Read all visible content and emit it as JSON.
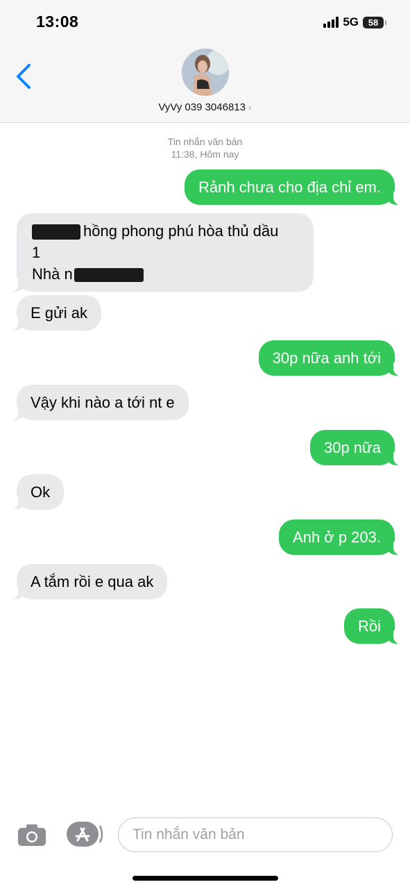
{
  "status_bar": {
    "time": "13:08",
    "network": "5G",
    "battery": "58",
    "icons": [
      "signal-icon",
      "battery-icon"
    ]
  },
  "header": {
    "back_icon": "chevron-left-icon",
    "contact_name": "VyVy 039 3046813",
    "contact_chevron": "›"
  },
  "thread": {
    "meta_type": "Tin nhắn văn bản",
    "meta_time": "11:38, Hôm nay",
    "messages": [
      {
        "direction": "out",
        "text": "Rảnh chưa cho địa chỉ em."
      },
      {
        "direction": "in",
        "line1": "hồng phong phú hòa thủ dầu",
        "line2": "1",
        "line3": "Nhà n"
      },
      {
        "direction": "in",
        "text": "E gửi ak"
      },
      {
        "direction": "out",
        "text": "30p nữa anh tới"
      },
      {
        "direction": "in",
        "text": "Vậy khi nào a tới nt e"
      },
      {
        "direction": "out",
        "text": "30p nữa"
      },
      {
        "direction": "in",
        "text": "Ok"
      },
      {
        "direction": "out",
        "text": "Anh ở p 203."
      },
      {
        "direction": "in",
        "text": "A tắm rồi e qua ak"
      },
      {
        "direction": "out",
        "text": "Rồi"
      }
    ]
  },
  "input_bar": {
    "placeholder": "Tin nhắn văn bản",
    "icons": [
      "camera-icon",
      "app-store-icon"
    ]
  },
  "colors": {
    "outgoing_bubble": "#34c759",
    "incoming_bubble": "#e9e9eb",
    "accent": "#0a84ff"
  }
}
